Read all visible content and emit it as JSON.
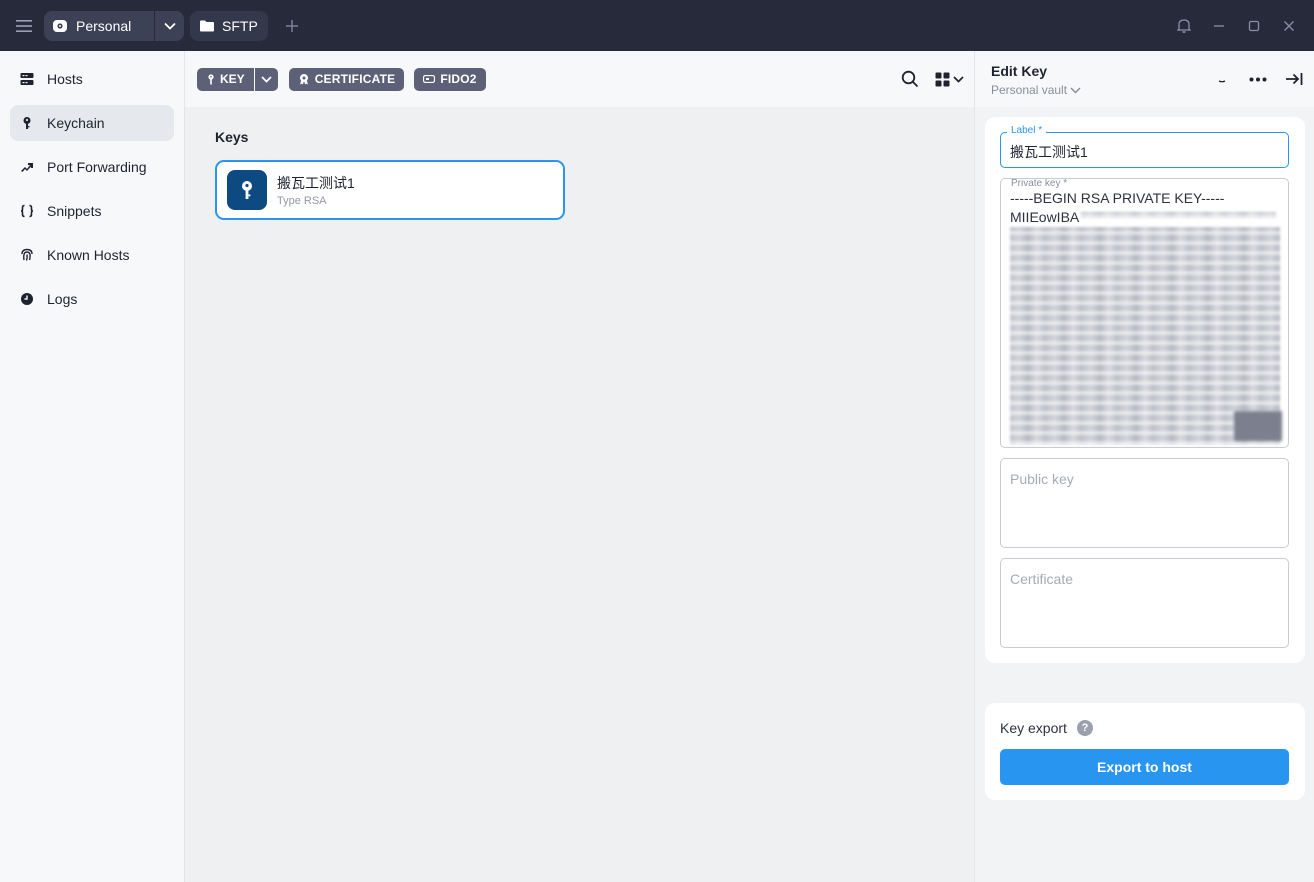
{
  "titlebar": {
    "vault_tab_label": "Personal",
    "sftp_tab_label": "SFTP"
  },
  "sidebar": {
    "items": [
      {
        "label": "Hosts",
        "icon": "hosts-icon"
      },
      {
        "label": "Keychain",
        "icon": "key-icon"
      },
      {
        "label": "Port Forwarding",
        "icon": "port-forwarding-icon"
      },
      {
        "label": "Snippets",
        "icon": "braces-icon"
      },
      {
        "label": "Known Hosts",
        "icon": "fingerprint-icon"
      },
      {
        "label": "Logs",
        "icon": "clock-icon"
      }
    ],
    "active": "Keychain"
  },
  "toolbar": {
    "key_label": "KEY",
    "certificate_label": "CERTIFICATE",
    "fido2_label": "FIDO2"
  },
  "main": {
    "section_title": "Keys",
    "keys": [
      {
        "title": "搬瓦工测试1",
        "subtitle": "Type RSA"
      }
    ]
  },
  "panel": {
    "title": "Edit Key",
    "vault": "Personal vault",
    "label_field": {
      "label": "Label *",
      "value": "搬瓦工测试1"
    },
    "private_key_field": {
      "label": "Private key *",
      "line1": "-----BEGIN RSA PRIVATE KEY-----",
      "line2": "MIIEowIBA"
    },
    "public_key_placeholder": "Public key",
    "certificate_placeholder": "Certificate",
    "key_export_label": "Key export",
    "help_glyph": "?",
    "export_button": "Export to host"
  },
  "colors": {
    "titlebar_bg": "#272a3b",
    "accent": "#2896f0",
    "pill_bg": "#5c6177",
    "key_avatar_bg": "#0d4a82"
  }
}
